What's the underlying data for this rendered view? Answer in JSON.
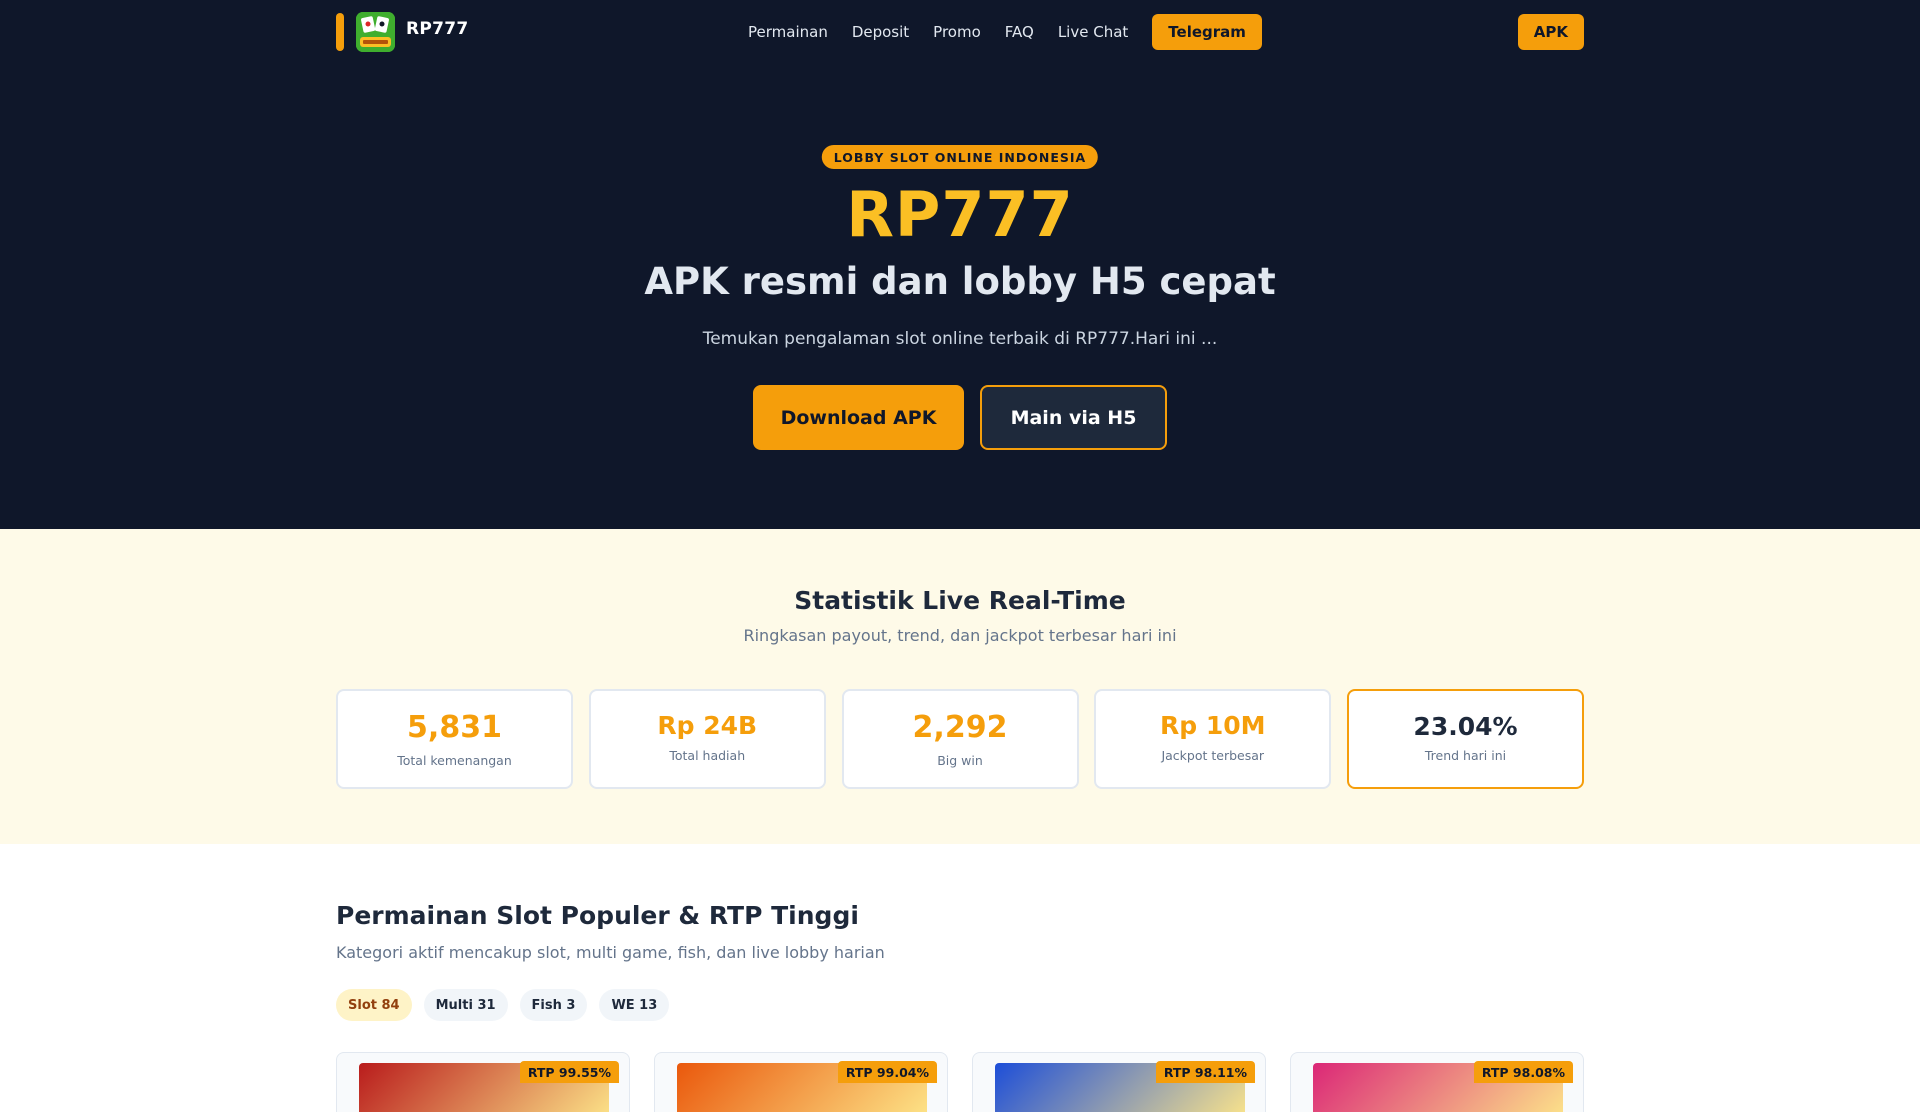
{
  "nav": {
    "brand": "RP777",
    "links": [
      "Permainan",
      "Deposit",
      "Promo",
      "FAQ",
      "Live Chat"
    ],
    "telegram_label": "Telegram",
    "apk_label": "APK"
  },
  "hero": {
    "badge": "LOBBY SLOT ONLINE INDONESIA",
    "title": "RP777",
    "subtitle": "APK resmi dan lobby H5 cepat",
    "description": "Temukan pengalaman slot online terbaik di RP777.Hari ini ...",
    "download_label": "Download APK",
    "h5_label": "Main via H5"
  },
  "stats": {
    "title": "Statistik Live Real-Time",
    "subtitle": "Ringkasan payout, trend, dan jackpot terbesar hari ini",
    "cards": [
      {
        "value": "5,831",
        "label": "Total kemenangan"
      },
      {
        "value": "Rp 24B",
        "label": "Total hadiah"
      },
      {
        "value": "2,292",
        "label": "Big win"
      },
      {
        "value": "Rp 10M",
        "label": "Jackpot terbesar"
      },
      {
        "value": "23.04%",
        "label": "Trend hari ini"
      }
    ]
  },
  "games": {
    "title": "Permainan Slot Populer & RTP Tinggi",
    "subtitle": "Kategori aktif mencakup slot, multi game, fish, dan live lobby harian",
    "chips": [
      "Slot 84",
      "Multi 31",
      "Fish 3",
      "WE 13"
    ],
    "cards": [
      {
        "rtp": "RTP 99.55%",
        "thumb_color": "#b91c1c"
      },
      {
        "rtp": "RTP 99.04%",
        "thumb_color": "#ea580c"
      },
      {
        "rtp": "RTP 98.11%",
        "thumb_color": "#1d4ed8"
      },
      {
        "rtp": "RTP 98.08%",
        "thumb_color": "#db2777"
      }
    ]
  },
  "colors": {
    "accent": "#f59e0b",
    "dark_bg": "#0f172a",
    "stats_bg": "#fefae8"
  }
}
